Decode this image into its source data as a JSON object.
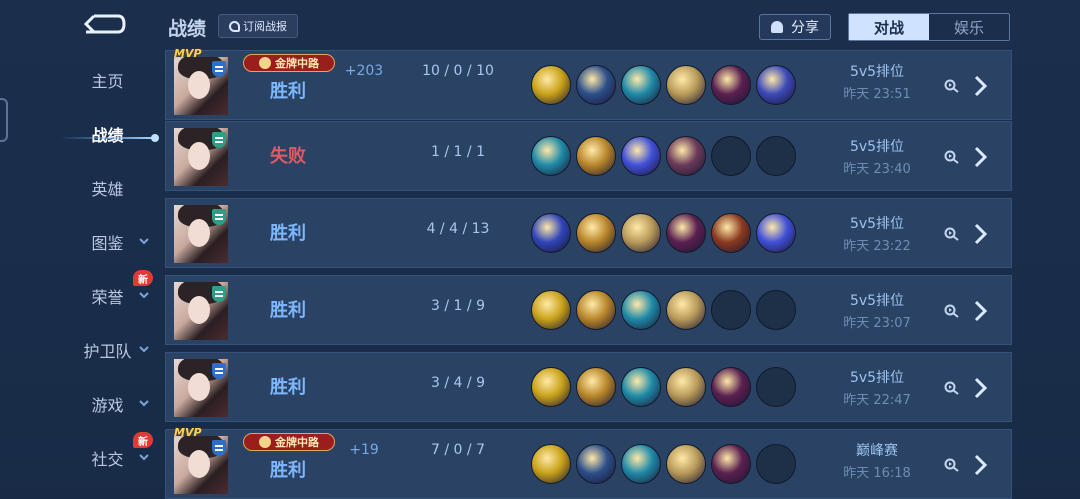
{
  "header": {
    "title": "战绩",
    "subscribe_label": "订阅战报",
    "share_label": "分享",
    "tab_battle": "对战",
    "tab_fun": "娱乐"
  },
  "sidebar": {
    "items": [
      {
        "label": "主页"
      },
      {
        "label": "战绩"
      },
      {
        "label": "英雄"
      },
      {
        "label": "图鉴"
      },
      {
        "label": "荣誉",
        "badge": "新"
      },
      {
        "label": "护卫队"
      },
      {
        "label": "游戏"
      },
      {
        "label": "社交",
        "badge": "新"
      }
    ]
  },
  "matches": [
    {
      "mvp": "MVP",
      "tag": "金牌中路",
      "result": "胜利",
      "delta": "+203",
      "kda": "10 / 0 / 10",
      "mode": "5v5排位",
      "time": "昨天 23:51",
      "items": [
        "#c9a21a",
        "#2c4f8a",
        "#1f8aa8",
        "#b99b5a",
        "#5a2050",
        "#3b4ab8"
      ]
    },
    {
      "mvp": "",
      "tag": "",
      "result": "失败",
      "delta": "",
      "kda": "1 / 1 / 1",
      "mode": "5v5排位",
      "time": "昨天 23:40",
      "items": [
        "#1f8aa8",
        "#b8862a",
        "#4050d8",
        "#6a3a5a",
        "",
        ""
      ]
    },
    {
      "mvp": "",
      "tag": "",
      "result": "胜利",
      "delta": "",
      "kda": "4 / 4 / 13",
      "mode": "5v5排位",
      "time": "昨天 23:22",
      "items": [
        "#3045b8",
        "#b8862a",
        "#b99b5a",
        "#5a2050",
        "#8a3a20",
        "#4050d8"
      ]
    },
    {
      "mvp": "",
      "tag": "",
      "result": "胜利",
      "delta": "",
      "kda": "3 / 1 / 9",
      "mode": "5v5排位",
      "time": "昨天 23:07",
      "items": [
        "#c9a21a",
        "#b8862a",
        "#1f8aa8",
        "#b99b5a",
        "",
        ""
      ]
    },
    {
      "mvp": "",
      "tag": "",
      "result": "胜利",
      "delta": "",
      "kda": "3 / 4 / 9",
      "mode": "5v5排位",
      "time": "昨天 22:47",
      "items": [
        "#c9a21a",
        "#b8862a",
        "#1f8aa8",
        "#b99b5a",
        "#5a2050",
        ""
      ]
    },
    {
      "mvp": "MVP",
      "tag": "金牌中路",
      "result": "胜利",
      "delta": "+19",
      "kda": "7 / 0 / 7",
      "mode": "巅峰赛",
      "time": "昨天 16:18",
      "items": [
        "#c9a21a",
        "#2c4f8a",
        "#1f8aa8",
        "#b99b5a",
        "#5a2050",
        ""
      ]
    }
  ]
}
